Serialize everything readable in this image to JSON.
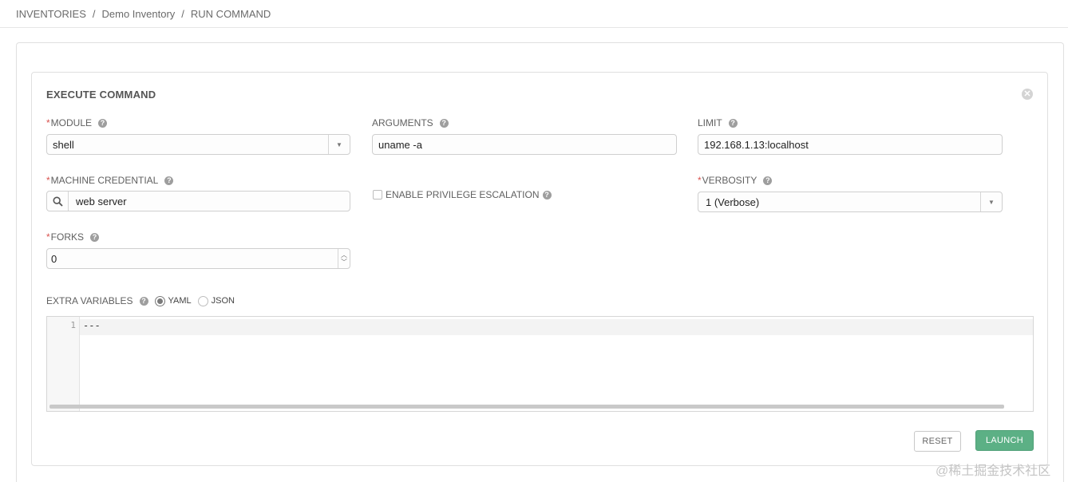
{
  "breadcrumb": {
    "items": [
      "INVENTORIES",
      "Demo Inventory",
      "RUN COMMAND"
    ],
    "separator": "/"
  },
  "panel": {
    "title": "EXECUTE COMMAND",
    "close_icon": "close-icon"
  },
  "fields": {
    "module": {
      "label": "MODULE",
      "required": true,
      "value": "shell"
    },
    "arguments": {
      "label": "ARGUMENTS",
      "required": false,
      "value": "uname -a"
    },
    "limit": {
      "label": "LIMIT",
      "required": false,
      "value": "192.168.1.13:localhost"
    },
    "machine_credential": {
      "label": "MACHINE CREDENTIAL",
      "required": true,
      "value": "web server"
    },
    "privilege_escalation": {
      "label": "ENABLE PRIVILEGE ESCALATION",
      "checked": false
    },
    "verbosity": {
      "label": "VERBOSITY",
      "required": true,
      "value": "1 (Verbose)"
    },
    "forks": {
      "label": "FORKS",
      "required": true,
      "value": "0"
    }
  },
  "extra_variables": {
    "label": "EXTRA VARIABLES",
    "formats": [
      {
        "label": "YAML",
        "selected": true
      },
      {
        "label": "JSON",
        "selected": false
      }
    ],
    "line_numbers": [
      "1"
    ],
    "content": "---"
  },
  "buttons": {
    "reset": "RESET",
    "launch": "LAUNCH"
  },
  "colors": {
    "launch": "#5cb085",
    "required": "#d9534f"
  },
  "watermark": "@稀土掘金技术社区",
  "help_glyph": "?",
  "close_glyph": "✕",
  "spinner_up": "︿",
  "spinner_down": "﹀",
  "dropdown_arrow": "▼"
}
